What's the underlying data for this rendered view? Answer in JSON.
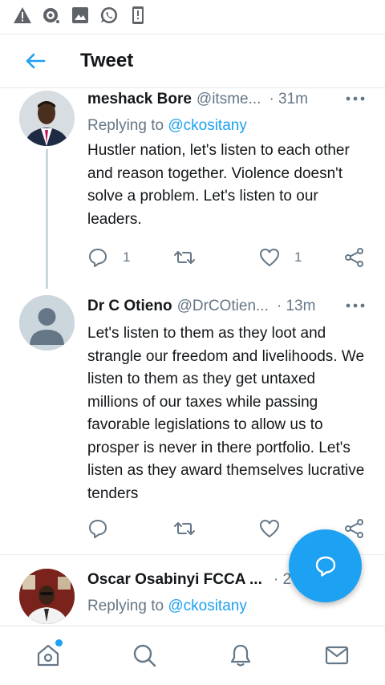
{
  "status_bar": {
    "icons": [
      "alert-icon",
      "hotspot-icon",
      "gallery-icon",
      "whatsapp-icon",
      "phone-alert-icon"
    ]
  },
  "header": {
    "title": "Tweet"
  },
  "tweets": [
    {
      "name": "meshack Bore",
      "handle": "@itsme...",
      "time": "· 31m",
      "replying_label": "Replying to",
      "replying_to": "@ckositany",
      "text": "Hustler nation, let's listen to each other and reason together. Violence doesn't solve a problem. Let's listen to our leaders.",
      "reply_count": "1",
      "retweet_count": "",
      "like_count": "1"
    },
    {
      "name": "Dr C Otieno",
      "handle": "@DrCOtien...",
      "time": "· 13m",
      "text": "Let's listen to them as they loot and strangle our freedom and livelihoods. We listen to them as they get untaxed millions of our taxes while passing favorable legislations to allow us to prosper is never in there portfolio. Let's listen as they award themselves lucrative tenders",
      "reply_count": "",
      "retweet_count": "",
      "like_count": ""
    },
    {
      "name": "Oscar Osabinyi FCCA ...",
      "handle": "",
      "time": "· 2",
      "replying_label": "Replying to",
      "replying_to": "@ckositany"
    }
  ],
  "colors": {
    "accent": "#1da1f2",
    "text": "#14171a",
    "muted": "#657786",
    "divider": "#e6ecf0"
  },
  "bottom_nav": {
    "items": [
      "home-icon",
      "search-icon",
      "notifications-icon",
      "messages-icon"
    ]
  }
}
